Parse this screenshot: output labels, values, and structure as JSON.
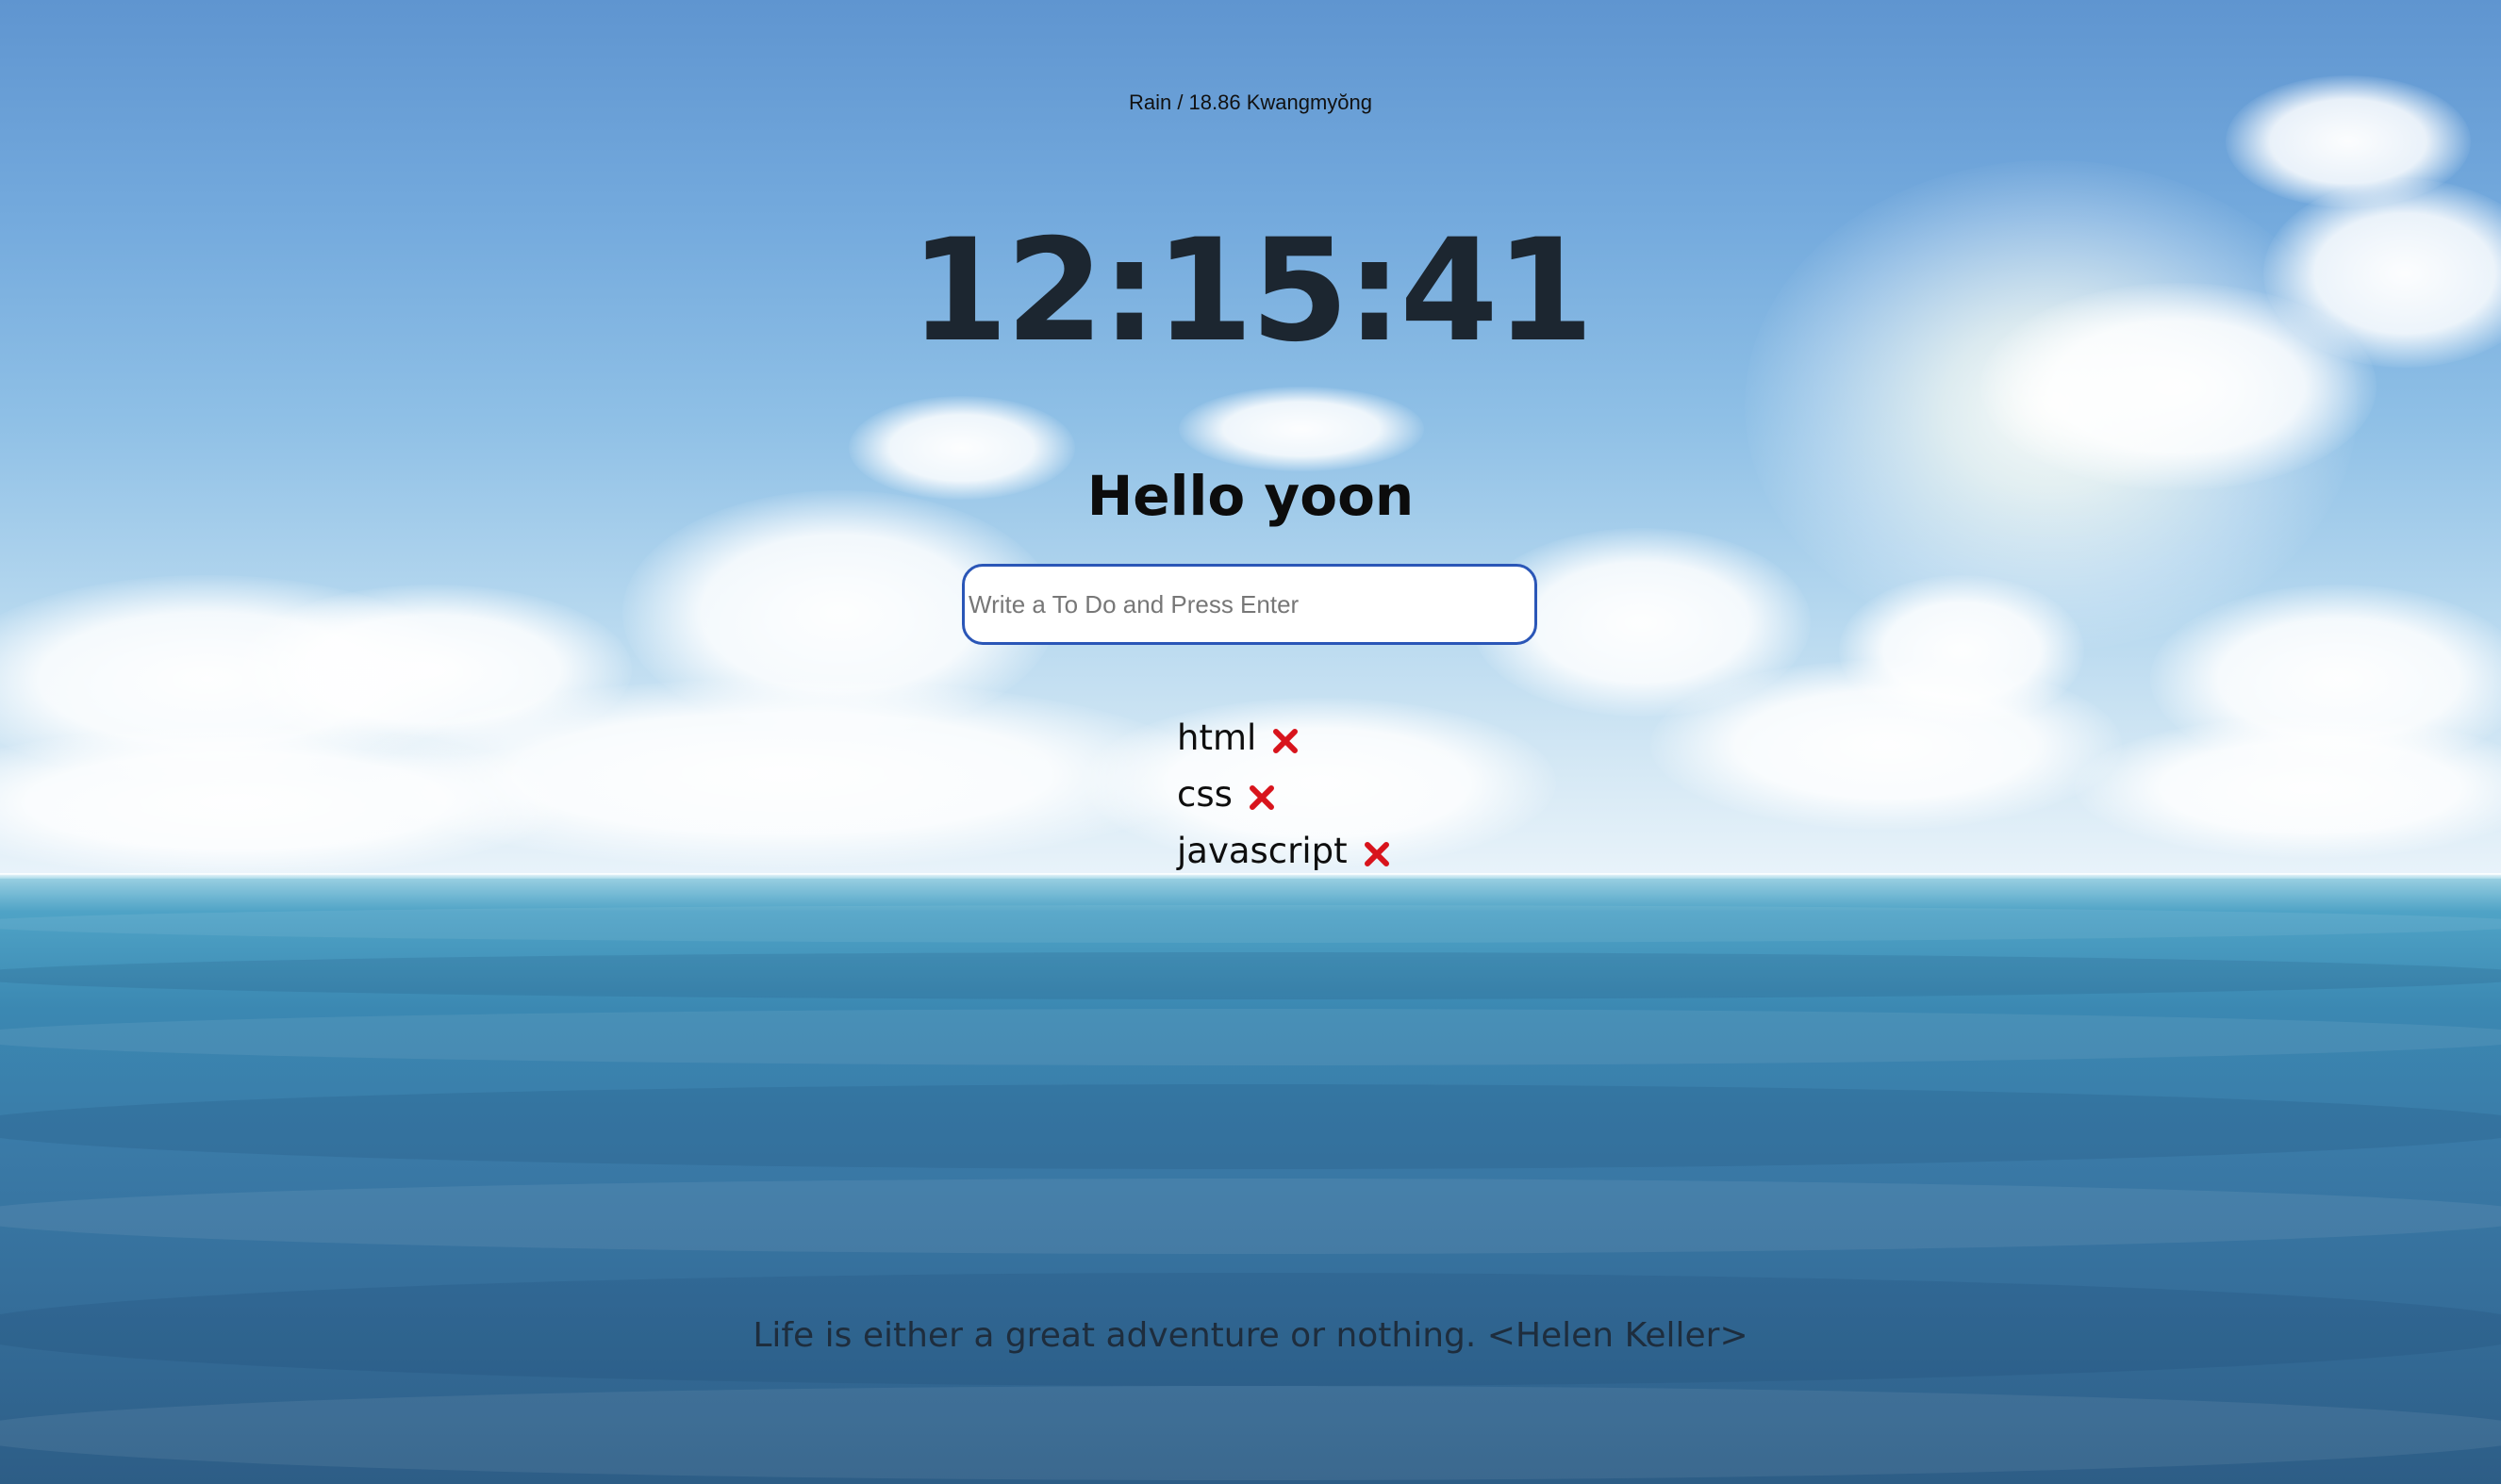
{
  "weather": {
    "text": "Rain / 18.86 Kwangmyŏng"
  },
  "clock": {
    "time": "12:15:41"
  },
  "greeting": {
    "text": "Hello yoon"
  },
  "todo_form": {
    "placeholder": "Write a To Do and Press Enter",
    "value": ""
  },
  "todos": [
    {
      "text": "html",
      "delete_icon": "red-x-icon"
    },
    {
      "text": "css",
      "delete_icon": "red-x-icon"
    },
    {
      "text": "javascript",
      "delete_icon": "red-x-icon"
    }
  ],
  "quote": {
    "text": "Life is either a great adventure or nothing. <Helen Keller>"
  },
  "background": {
    "description_icon": "sky-and-sea-photo",
    "colors": {
      "sky": "#74aadd",
      "sea": "#3a7aa7",
      "input_border": "#2a56b7",
      "delete_icon": "#d8141c"
    }
  }
}
